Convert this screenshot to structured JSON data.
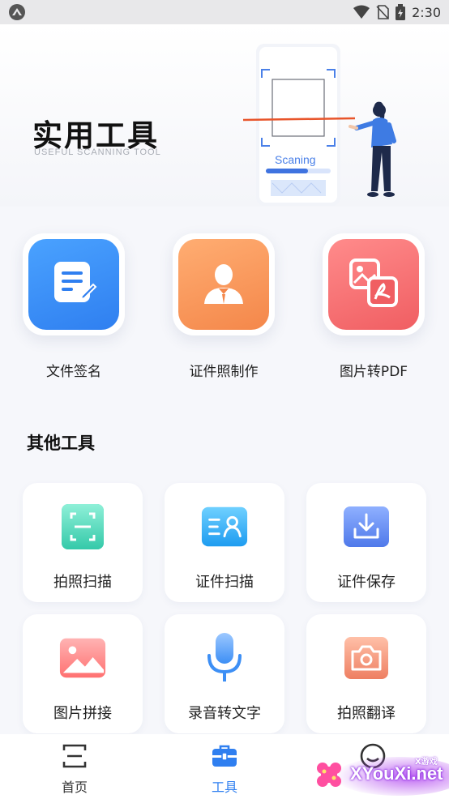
{
  "status_bar": {
    "time": "2:30"
  },
  "hero": {
    "title": "实用工具",
    "subtitle": "USEFUL SCANNING TOOL",
    "scan_label": "Scaning"
  },
  "features": [
    {
      "label": "文件签名",
      "icon": "sign-document-icon",
      "color": "#2f7ff0"
    },
    {
      "label": "证件照制作",
      "icon": "id-photo-icon",
      "color": "#f4874a"
    },
    {
      "label": "图片转PDF",
      "icon": "image-to-pdf-icon",
      "color": "#f05e62"
    }
  ],
  "other_tools": {
    "title": "其他工具",
    "items": [
      {
        "label": "拍照扫描",
        "icon": "photo-scan-icon",
        "color": "#3dd0b4"
      },
      {
        "label": "证件扫描",
        "icon": "id-scan-icon",
        "color": "#29a9f5"
      },
      {
        "label": "证件保存",
        "icon": "download-save-icon",
        "color": "#5b86f0"
      },
      {
        "label": "图片拼接",
        "icon": "image-stitch-icon",
        "color": "#ff7b7b"
      },
      {
        "label": "录音转文字",
        "icon": "microphone-icon",
        "color": "#3d8ff5"
      },
      {
        "label": "拍照翻译",
        "icon": "camera-translate-icon",
        "color": "#f0866a"
      }
    ]
  },
  "bottom_nav": {
    "items": [
      {
        "label": "首页",
        "icon": "home-scan-icon",
        "active": false
      },
      {
        "label": "工具",
        "icon": "toolbox-icon",
        "active": true
      },
      {
        "label": "",
        "icon": "profile-icon",
        "active": false
      }
    ]
  },
  "watermark": {
    "text": "XYouXi.net",
    "small": "X游戏"
  }
}
